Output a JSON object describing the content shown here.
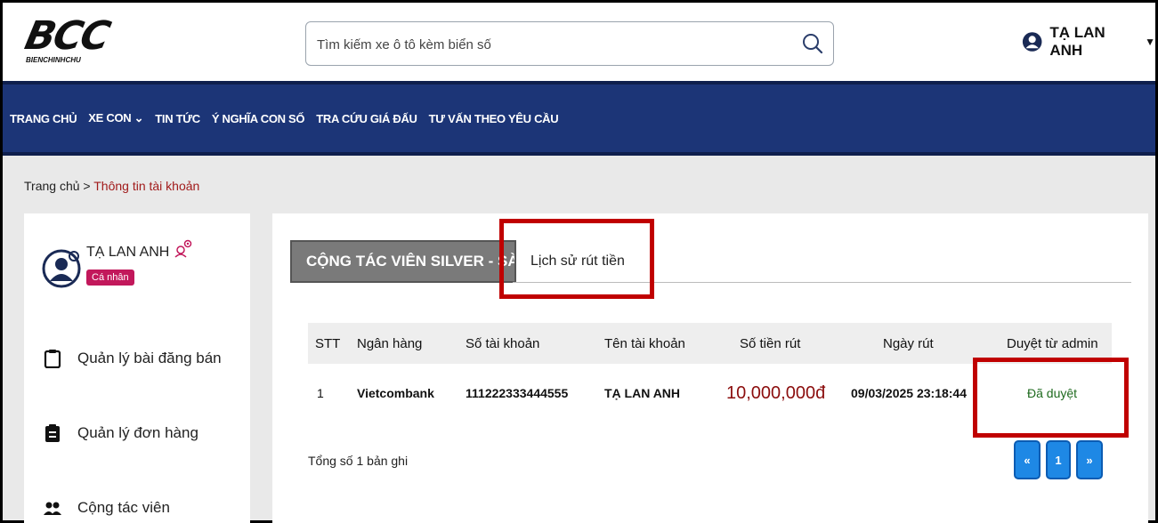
{
  "logo": {
    "mark": "BCC",
    "sub": "BIENCHINHCHU"
  },
  "search": {
    "placeholder": "Tìm kiếm xe ô tô kèm biển số",
    "icon": "search-icon"
  },
  "user_menu": {
    "name": "TẠ LAN ANH",
    "icon": "user-circle-icon",
    "caret": "▼"
  },
  "nav": {
    "items": [
      {
        "label": "TRANG CHỦ"
      },
      {
        "label": "XE CON ⌄"
      },
      {
        "label": "TIN TỨC"
      },
      {
        "label": "Ý NGHĨA CON SỐ"
      },
      {
        "label": "TRA CỨU GIÁ ĐẤU"
      },
      {
        "label": "TƯ VẤN THEO YÊU CẦU"
      }
    ]
  },
  "breadcrumb": {
    "home": "Trang chủ",
    "sep": ">",
    "current": "Thông tin tài khoản"
  },
  "sidebar": {
    "user_name": "TẠ LAN ANH",
    "badge": "Cá nhân",
    "items": [
      {
        "label": "Quản lý bài đăng bán",
        "icon": "clipboard-icon"
      },
      {
        "label": "Quản lý đơn hàng",
        "icon": "clipboard-list-icon"
      },
      {
        "label": "Cộng tác viên",
        "icon": "users-icon"
      }
    ]
  },
  "tabs": {
    "ctv": "CỘNG TÁC VIÊN SILVER - SÀN",
    "history": "Lịch sử rút tiền"
  },
  "table": {
    "headers": [
      "STT",
      "Ngân hàng",
      "Số tài khoản",
      "Tên tài khoản",
      "Số tiền rút",
      "Ngày rút",
      "Duyệt từ admin"
    ],
    "rows": [
      {
        "stt": "1",
        "bank": "Vietcombank",
        "account": "111222333444555",
        "holder": "TẠ LAN ANH",
        "amount": "10,000,000đ",
        "date": "09/03/2025 23:18:44",
        "status": "Đã duyệt"
      }
    ]
  },
  "total": "Tổng số 1 bản ghi",
  "pagination": {
    "prev": "«",
    "page": "1",
    "next": "»"
  },
  "colors": {
    "nav_bg": "#1c3577",
    "highlight": "#c00000",
    "money": "#8b0d0d",
    "approved": "#1e6a1e",
    "badge": "#c2185b",
    "pager": "#1e88e5"
  }
}
